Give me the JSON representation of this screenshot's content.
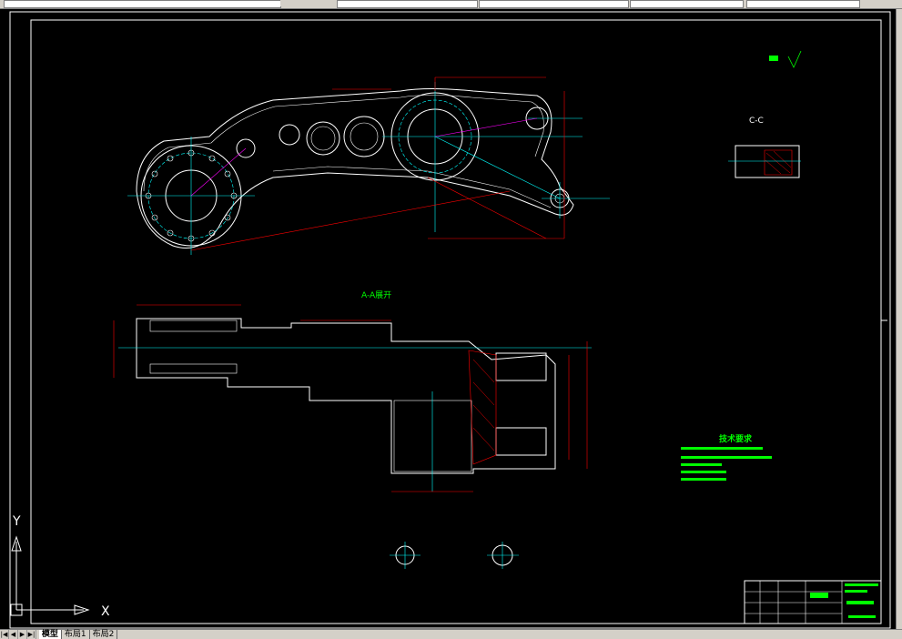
{
  "toolbar": {
    "fields": [
      "",
      "",
      "",
      "",
      "",
      ""
    ]
  },
  "drawing": {
    "section_cc_label": "C-C",
    "section_aa_label": "A-A展开",
    "tech_requirements_title": "技术要求",
    "ucs": {
      "x_label": "X",
      "y_label": "Y"
    }
  },
  "layout_tabs": {
    "nav_buttons": [
      "|◀",
      "◀",
      "▶",
      "▶|"
    ],
    "tabs": [
      "模型",
      "布局1",
      "布局2"
    ],
    "active": "模型"
  },
  "colors": {
    "background": "#000000",
    "outline": "#ffffff",
    "dimension": "#ff0000",
    "center": "#00ffff",
    "text": "#00ff00",
    "hidden": "#ff00ff",
    "hatch": "#ff0000"
  }
}
